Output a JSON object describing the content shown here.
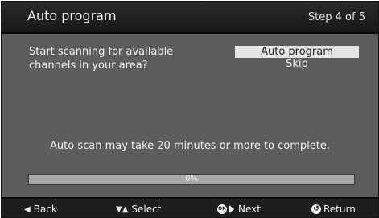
{
  "header": {
    "title": "Auto program",
    "step": "Step 4 of 5"
  },
  "prompt": "Start scanning for available channels in your area?",
  "menu": {
    "items": [
      {
        "label": "Auto program",
        "selected": true
      },
      {
        "label": "Skip",
        "selected": false
      }
    ]
  },
  "note": "Auto scan may take 20 minutes or more to complete.",
  "progress": {
    "label": "0%",
    "value_percent": 0
  },
  "footer": {
    "back_label": "Back",
    "select_label": "Select",
    "ok_glyph_text": "OK",
    "next_label": "Next",
    "return_label": "Return"
  }
}
